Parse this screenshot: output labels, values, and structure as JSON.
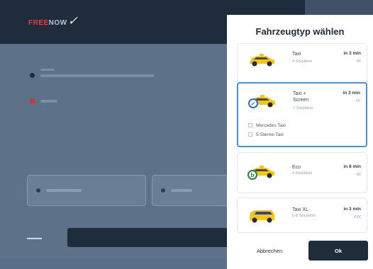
{
  "panel": {
    "title": "Fahrzeugtyp wählen",
    "options": [
      {
        "name": "Taxi",
        "seats": "4 Sitzplätze",
        "time": "in 3 min",
        "price": "€€",
        "selected": false
      },
      {
        "name": "Taxi + Screen",
        "seats": "2 Sitzplätze",
        "time": "in 3 min",
        "price": "€€",
        "selected": true,
        "extras": [
          "Mercedes Taxi",
          "5-Sterne-Taxi"
        ]
      },
      {
        "name": "Eco",
        "seats": "4 Sitzplätze",
        "time": "in 8 min",
        "price": "€€",
        "selected": false
      },
      {
        "name": "Taxi XL",
        "seats": "5-8 Sitzplätze",
        "time": "in 3 min",
        "price": "€€€",
        "selected": false
      }
    ],
    "cancel_label": "Abbrechen",
    "ok_label": "Ok"
  },
  "icons": {
    "selected_check": "✓",
    "eco_leaf": "b"
  },
  "colors": {
    "navy": "#1e2c3c",
    "accent": "#4a90e2",
    "taxi_yellow": "#f5c518",
    "eco_green": "#1f8a3a"
  }
}
